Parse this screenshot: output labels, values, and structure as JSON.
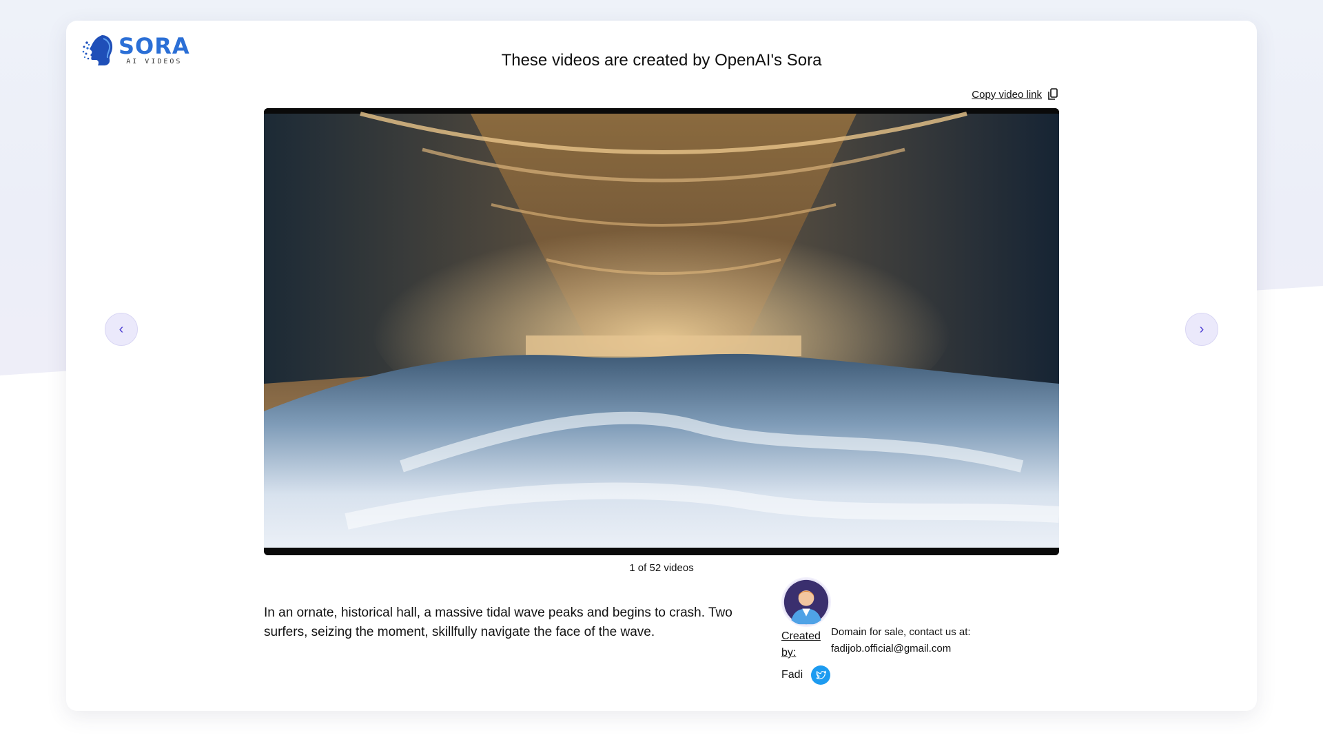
{
  "logo": {
    "name": "SORA",
    "subtitle": "AI VIDEOS"
  },
  "header": {
    "title": "These videos are created by OpenAI's Sora"
  },
  "toolbar": {
    "copy_link_label": "Copy video link"
  },
  "video": {
    "scene": "ornate historical hall with a massive tidal wave"
  },
  "navigation": {
    "prev_icon": "‹",
    "next_icon": "›"
  },
  "counter": {
    "text": "1 of 52 videos",
    "current": 1,
    "total": 52
  },
  "description": {
    "text": "In an ornate, historical hall, a massive tidal wave peaks and begins to crash. Two surfers, seizing the moment, skillfully navigate the face of the wave."
  },
  "creator": {
    "label": "Created by:",
    "name": "Fadi"
  },
  "sale": {
    "line1": "Domain for sale, contact us at:",
    "email": "fadijob.official@gmail.com"
  },
  "colors": {
    "brand": "#2b6fd6",
    "nav_button": "#ebe9fb",
    "nav_arrow": "#4b3bd3",
    "twitter": "#1d9bf0"
  }
}
